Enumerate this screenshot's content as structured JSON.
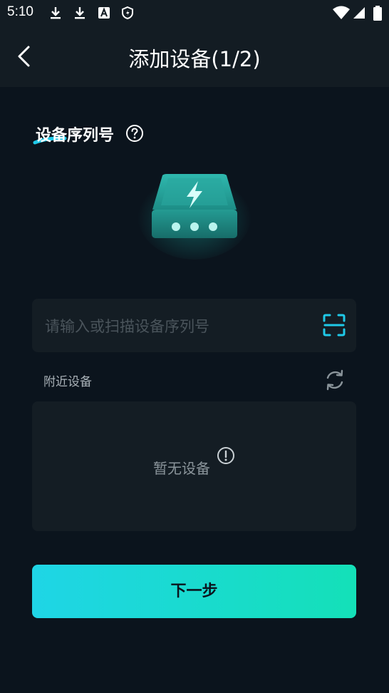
{
  "status_bar": {
    "time": "5:10",
    "left_icons": [
      "download-icon",
      "download-icon",
      "app-a-icon",
      "shield-icon"
    ],
    "right_icons": [
      "wifi-icon",
      "signal-icon",
      "battery-icon"
    ]
  },
  "app_bar": {
    "title": "添加设备(1/2)",
    "back_icon": "chevron-left-icon"
  },
  "serial_section": {
    "title": "设备序列号",
    "help_icon": "question-circle-icon",
    "input_placeholder": "请输入或扫描设备序列号",
    "input_value": "",
    "scan_icon": "scan-icon"
  },
  "nearby": {
    "label": "附近设备",
    "refresh_icon": "refresh-icon",
    "empty_text": "暂无设备",
    "empty_icon": "exclamation-circle-icon"
  },
  "next_button": {
    "label": "下一步"
  },
  "colors": {
    "background": "#0b141d",
    "bar": "#131c23",
    "card": "#141d24",
    "accent": "#1fc9e8",
    "button_start": "#1fd5e6",
    "button_end": "#14e0b8"
  }
}
